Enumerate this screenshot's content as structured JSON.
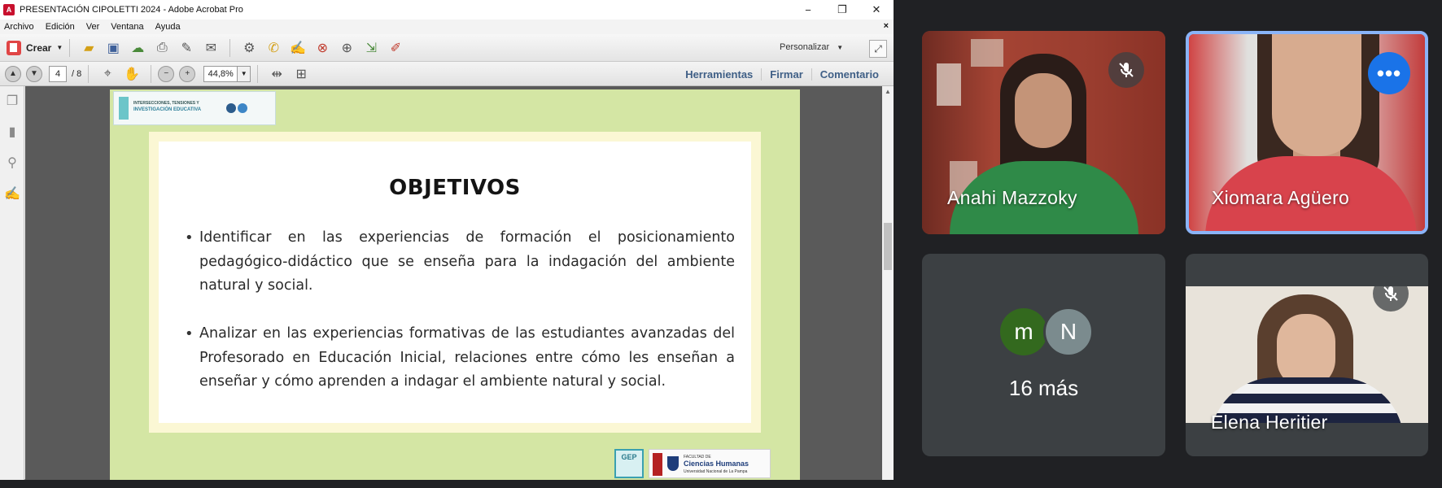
{
  "acrobat": {
    "title": "PRESENTACIÓN CIPOLETTI 2024 - Adobe Acrobat Pro",
    "window_controls": [
      "−",
      "❐",
      "✕"
    ],
    "menu": [
      "Archivo",
      "Edición",
      "Ver",
      "Ventana",
      "Ayuda"
    ],
    "menu_close": "×",
    "toolbar": {
      "crear_label": "Crear",
      "personalizar_label": "Personalizar",
      "icons": [
        "folder-open-icon",
        "save-icon",
        "cloud-icon",
        "print-icon",
        "edit-icon",
        "email-icon",
        "gear-icon",
        "comment-icon",
        "stamp-icon",
        "delete-page-icon",
        "attach-icon",
        "export-icon",
        "sign-icon"
      ]
    },
    "nav": {
      "page_current": "4",
      "page_total": "/ 8",
      "zoom": "44,8%",
      "links": [
        "Herramientas",
        "Firmar",
        "Comentario"
      ]
    }
  },
  "slide": {
    "heading": "OBJETIVOS",
    "bullets": [
      "Identificar en las experiencias de formación el posicionamiento pedagógico-didáctico que se enseña para la indagación del ambiente natural y social.",
      "Analizar en las experiencias formativas de las estudiantes avanzadas del Profesorado en Educación Inicial, relaciones entre cómo les enseñan a enseñar y cómo aprenden a indagar el ambiente natural y social."
    ],
    "header_logo": {
      "line1": "INTERSECCIONES, TENSIONES Y",
      "line2": "INVESTIGACIÓN EDUCATIVA"
    },
    "footer_logo": {
      "gep": "GEP",
      "faculty_small": "FACULTAD DE",
      "faculty": "Ciencias Humanas",
      "university": "Universidad Nacional de La Pampa"
    }
  },
  "meet": {
    "participants": [
      {
        "name": "Anahi Mazzoky",
        "muted": true
      },
      {
        "name": "Xiomara Agüero",
        "speaking": true
      },
      {
        "name": "Elena Heritier",
        "muted": true
      }
    ],
    "more": {
      "avatars": [
        "m",
        "N"
      ],
      "label": "16 más"
    },
    "more_options_icon": "•••",
    "colors": {
      "speaking_border": "#8ab4f8",
      "more_button": "#1a73e8",
      "tile_bg": "#3c4043"
    }
  }
}
